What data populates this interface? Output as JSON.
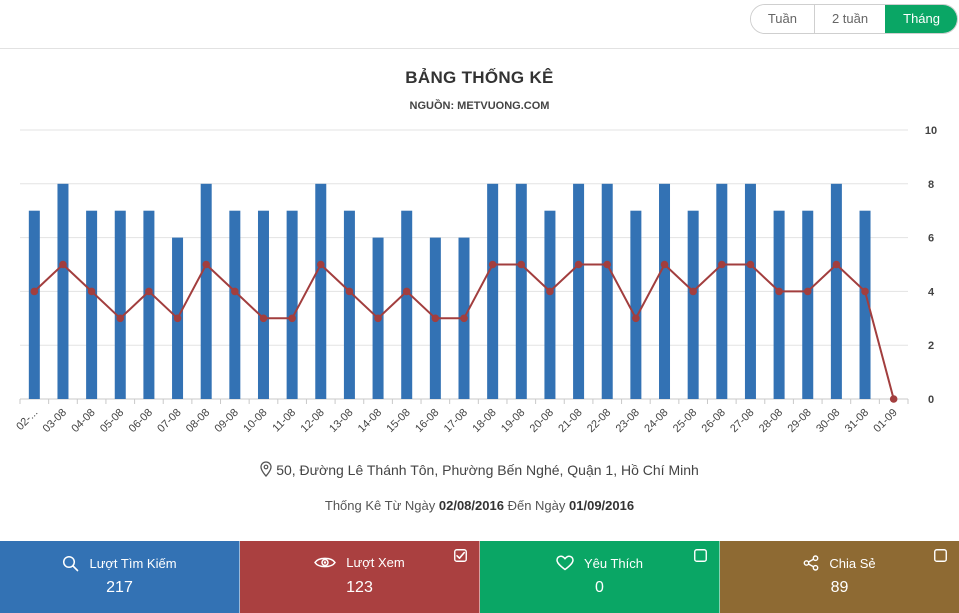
{
  "period_tabs": [
    "Tuần",
    "2 tuần",
    "Tháng"
  ],
  "active_tab": "Tháng",
  "address": "50, Đường Lê Thánh Tôn, Phường Bến Nghé, Quận 1, Hồ Chí Minh",
  "range": {
    "prefix": "Thống Kê Từ Ngày",
    "from": "02/08/2016",
    "middle": "Đến Ngày",
    "to": "01/09/2016"
  },
  "stats": [
    {
      "label": "Lượt Tìm Kiếm",
      "value": "217",
      "icon": "search-icon",
      "color": "#3372b4",
      "check": "none"
    },
    {
      "label": "Lượt Xem",
      "value": "123",
      "icon": "eye-icon",
      "color": "#aa4040",
      "check": "checked"
    },
    {
      "label": "Yêu Thích",
      "value": "0",
      "icon": "heart-icon",
      "color": "#0aa665",
      "check": "unchecked"
    },
    {
      "label": "Chia Sẻ",
      "value": "89",
      "icon": "share-icon",
      "color": "#8e6a33",
      "check": "unchecked"
    }
  ],
  "chart_data": {
    "type": "bar",
    "title": "BẢNG THỐNG KÊ",
    "subtitle": "NGUỒN: METVUONG.COM",
    "categories": [
      "02-08",
      "03-08",
      "04-08",
      "05-08",
      "06-08",
      "07-08",
      "08-08",
      "09-08",
      "10-08",
      "11-08",
      "12-08",
      "13-08",
      "14-08",
      "15-08",
      "16-08",
      "17-08",
      "18-08",
      "19-08",
      "20-08",
      "21-08",
      "22-08",
      "23-08",
      "24-08",
      "25-08",
      "26-08",
      "27-08",
      "28-08",
      "29-08",
      "30-08",
      "31-08",
      "01-09"
    ],
    "category_labels": [
      "02-...",
      "03-08",
      "04-08",
      "05-08",
      "06-08",
      "07-08",
      "08-08",
      "09-08",
      "10-08",
      "11-08",
      "12-08",
      "13-08",
      "14-08",
      "15-08",
      "16-08",
      "17-08",
      "18-08",
      "19-08",
      "20-08",
      "21-08",
      "22-08",
      "23-08",
      "24-08",
      "25-08",
      "26-08",
      "27-08",
      "28-08",
      "29-08",
      "30-08",
      "31-08",
      "01-09"
    ],
    "series": [
      {
        "type": "bar",
        "color": "#3372b4",
        "values": [
          7,
          8,
          7,
          7,
          7,
          6,
          8,
          7,
          7,
          7,
          8,
          7,
          6,
          7,
          6,
          6,
          8,
          8,
          7,
          8,
          8,
          7,
          8,
          7,
          8,
          8,
          7,
          7,
          8,
          7,
          0
        ]
      },
      {
        "type": "line",
        "color": "#a23e3e",
        "values": [
          4,
          5,
          4,
          3,
          4,
          3,
          5,
          4,
          3,
          3,
          5,
          4,
          3,
          4,
          3,
          3,
          5,
          5,
          4,
          5,
          5,
          3,
          5,
          4,
          5,
          5,
          4,
          4,
          5,
          4,
          0
        ]
      }
    ],
    "ylim": [
      0,
      10
    ],
    "yticks": [
      0,
      2,
      4,
      6,
      8,
      10
    ],
    "y_axis_position": "right",
    "grid": true,
    "legend": "none"
  }
}
